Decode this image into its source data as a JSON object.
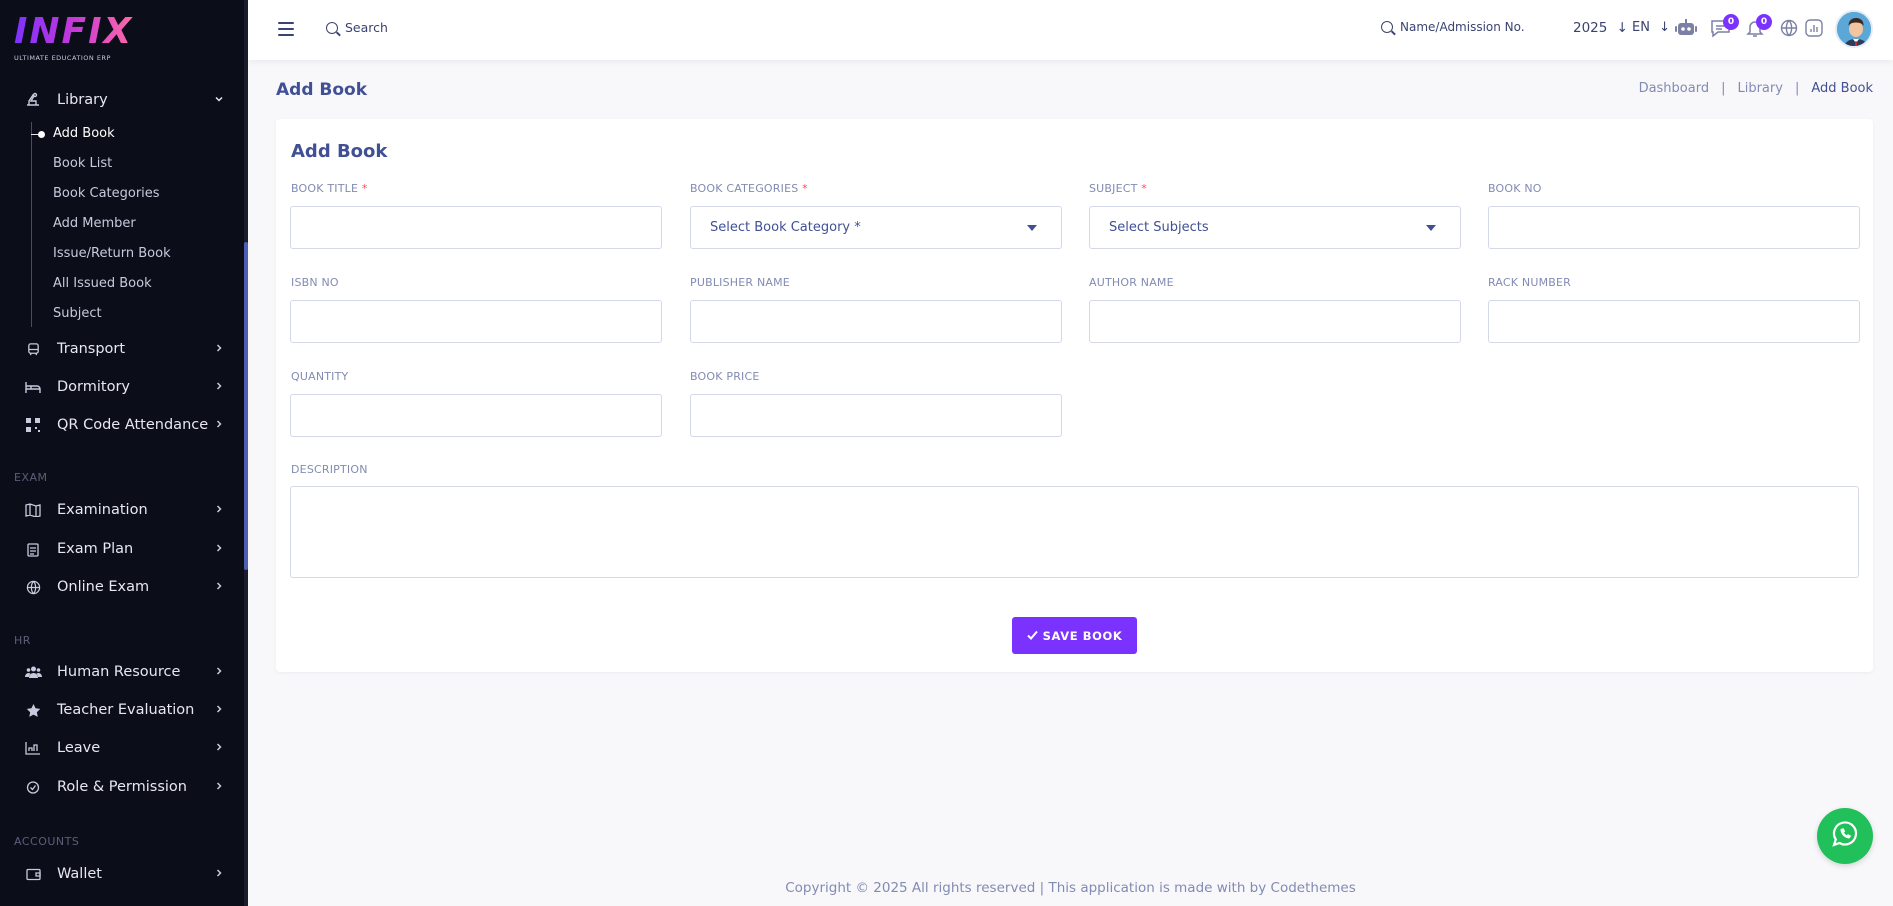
{
  "brand": {
    "logo_text": "INFIX",
    "tagline": "ULTIMATE EDUCATION ERP"
  },
  "sidebar": {
    "library": {
      "label": "Library",
      "icon": "book-reader-icon"
    },
    "library_sub": [
      {
        "label": "Add Book",
        "active": true
      },
      {
        "label": "Book List"
      },
      {
        "label": "Book Categories"
      },
      {
        "label": "Add Member"
      },
      {
        "label": "Issue/Return Book"
      },
      {
        "label": "All Issued Book"
      },
      {
        "label": "Subject"
      }
    ],
    "items_a": [
      {
        "label": "Transport",
        "icon": "bus-icon"
      },
      {
        "label": "Dormitory",
        "icon": "bed-icon"
      },
      {
        "label": "QR Code Attendance",
        "icon": "qr-icon"
      }
    ],
    "section_exam": "EXAM",
    "items_exam": [
      {
        "label": "Examination",
        "icon": "map-icon"
      },
      {
        "label": "Exam Plan",
        "icon": "clipboard-icon"
      },
      {
        "label": "Online Exam",
        "icon": "globe-icon"
      }
    ],
    "section_hr": "HR",
    "items_hr": [
      {
        "label": "Human Resource",
        "icon": "users-icon"
      },
      {
        "label": "Teacher Evaluation",
        "icon": "star-icon"
      },
      {
        "label": "Leave",
        "icon": "leave-icon"
      },
      {
        "label": "Role & Permission",
        "icon": "shield-icon"
      }
    ],
    "section_accounts": "ACCOUNTS",
    "items_accounts": [
      {
        "label": "Wallet",
        "icon": "wallet-icon"
      }
    ]
  },
  "topbar": {
    "search_placeholder": "Search",
    "admission_placeholder": "Name/Admission No.",
    "year": "2025",
    "language": "EN",
    "messages_count": "0",
    "notifications_count": "0"
  },
  "page": {
    "title": "Add Book",
    "breadcrumb": [
      "Dashboard",
      "Library",
      "Add Book"
    ],
    "card_title": "Add Book"
  },
  "form": {
    "book_title": "BOOK TITLE",
    "book_categories": "BOOK CATEGORIES",
    "book_categories_placeholder": "Select Book Category *",
    "subject": "SUBJECT",
    "subject_placeholder": "Select Subjects",
    "book_no": "BOOK NO",
    "isbn_no": "ISBN NO",
    "publisher_name": "PUBLISHER NAME",
    "author_name": "AUTHOR NAME",
    "rack_number": "RACK NUMBER",
    "quantity": "QUANTITY",
    "book_price": "BOOK PRICE",
    "description": "DESCRIPTION",
    "required_mark": "*",
    "save_label": "SAVE BOOK"
  },
  "footer": {
    "text": "Copyright © 2025 All rights reserved | This application is made with by Codethemes"
  },
  "colors": {
    "accent": "#7c32ff",
    "sidebar_bg": "#0b0d18",
    "whatsapp": "#22c05a"
  }
}
